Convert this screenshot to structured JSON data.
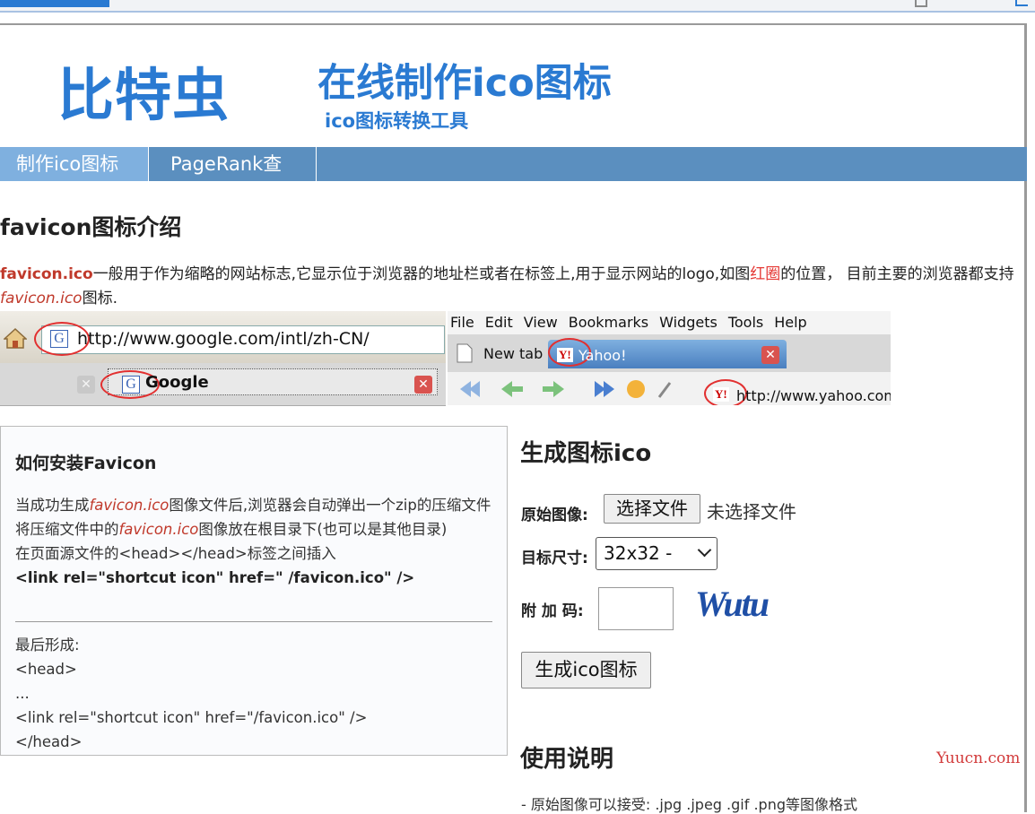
{
  "header": {
    "logo": "比特虫",
    "title": "在线制作ico图标",
    "subtitle": "ico图标转换工具"
  },
  "nav": {
    "items": [
      {
        "label": "制作ico图标"
      },
      {
        "label": "PageRank查询"
      }
    ]
  },
  "intro": {
    "heading": "favicon图标介绍",
    "fav_word": "favicon.ico",
    "text_a": "一般用于作为缩略的网站标志,它显示位于浏览器的地址栏或者在标签上,用于显示网站的logo,如图",
    "red_word": "红圈",
    "text_b": "的位置， 目前主要的浏览器都支持",
    "fav_italic": "favicon.ico",
    "text_c": "图标."
  },
  "illustration": {
    "left_url": "http://www.google.com/intl/zh-CN/",
    "left_tab": "Google",
    "g_glyph": "G",
    "right_menu": [
      "File",
      "Edit",
      "View",
      "Bookmarks",
      "Widgets",
      "Tools",
      "Help"
    ],
    "new_tab": "New tab",
    "yahoo_tab": "Yahoo!",
    "y_glyph": "Y!",
    "right_url": "http://www.yahoo.com"
  },
  "install": {
    "heading": "如何安装Favicon",
    "l1a": "当成功生成",
    "l1it": "favicon.ico",
    "l1b": "图像文件后,浏览器会自动弹出一个zip的压缩文件",
    "l2a": "将压缩文件中的",
    "l2it": "favicon.ico",
    "l2b": "图像放在根目录下(也可以是其他目录)",
    "l3": "在页面源文件的<head></head>标签之间插入",
    "l4": "<link rel=\"shortcut icon\" href=\" /favicon.ico\" />",
    "f1": "最后形成:",
    "f2": "<head>",
    "f3": "...",
    "f4": "<link rel=\"shortcut icon\" href=\"/favicon.ico\" />",
    "f5": "</head>"
  },
  "generator": {
    "heading": "生成图标ico",
    "source_label": "原始图像:",
    "file_button": "选择文件",
    "no_file": "未选择文件",
    "size_label": "目标尺寸:",
    "size_value": "32x32 -",
    "code_label": "附 加 码:",
    "code_value": "",
    "captcha": "Wutu",
    "submit": "生成ico图标"
  },
  "usage": {
    "heading": "使用说明",
    "line1": "- 原始图像可以接受: .jpg .jpeg .gif .png等图像格式"
  },
  "watermark": "Yuucn.com",
  "colors": {
    "brand_blue": "#2a7ad2",
    "nav_bg": "#5b8fbf",
    "nav_active": "#7fb0df",
    "highlight_red": "#c0392b"
  }
}
